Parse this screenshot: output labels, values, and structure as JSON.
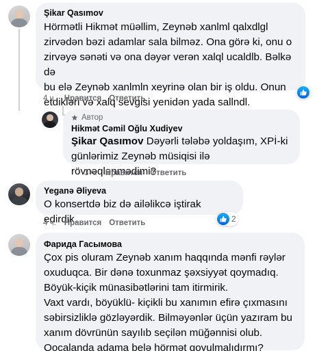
{
  "comments": [
    {
      "author": "Şikar Qasımov",
      "text": "Hörmətli Hikmət müəllim, Zeynəb xanlml qalxdlgl\nzirvədən bəzi adamlar sala bilməz. Ona görə ki, onu o\nzirvəyə sənəti və ona dəyər verən xalql ucaldlb. Bəlkə də\nbu elə Zeynəb xanlmln xeyrinə olan bir iş oldu. Onun\netdikləri və xalq sevgisi yenidən yada sallndl.",
      "time": "4 ч.",
      "like_label": "Нравится",
      "reply_label": "Ответить"
    },
    {
      "badge": "Автор",
      "author": "Hikmət Cəmil Oğlu Xudiyev",
      "mention": "Şikar Qasımov",
      "text": " Dəyərli tələbə yoldaşım, XPİ-ki\ngünlərimiz Zeynəb müsiqisi ilə rövnəqlənmədimi?",
      "time": "3 ч.",
      "like_label": "Нравится",
      "reply_label": "Ответить"
    },
    {
      "author": "Yeganə Əliyeva",
      "text": "O konsertdə biz də ailəlikcə iştirak edirdik.",
      "time": "4 ч.",
      "like_label": "Нравится",
      "reply_label": "Ответить",
      "reaction_count": "2"
    },
    {
      "author": "Фарида Гасымова",
      "text": "Çox pis oluram Zeynəb xanım haqqında mənfi rəylər\noxuduqca. Bir dənə toxunmaz şəxsiyyət qoymadıq.\nBöyük-kiçik münasibətlərini tam itirmirik.\nVaxt vardı, böyüklü- kiçikli bu xanımın efirə çıxmasını\nsəbirsizliklə gözləyərdik. Bilməyənlər üçün yazıram bu\nxanım dövrünün sayılıb seçilən müğənnisi olub.\nQocalanda adama belə hörmət qoyulmalıdırmı?"
    }
  ],
  "colors": {
    "bubble": "#f0f2f5",
    "meta_text": "#65676b",
    "like_blue": "#0062df"
  },
  "icons": [
    "like-icon",
    "author-star-icon"
  ]
}
